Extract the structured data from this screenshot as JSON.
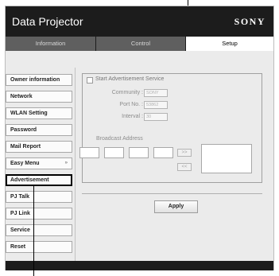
{
  "header": {
    "title": "Data Projector",
    "brand": "SONY"
  },
  "tabs": [
    {
      "label": "Information"
    },
    {
      "label": "Control"
    },
    {
      "label": "Setup"
    }
  ],
  "sidebar": {
    "items": [
      {
        "label": "Owner information"
      },
      {
        "label": "Network"
      },
      {
        "label": "WLAN Setting"
      },
      {
        "label": "Password"
      },
      {
        "label": "Mail Report"
      },
      {
        "label": "Easy Menu",
        "chevron": "»"
      },
      {
        "label": "Advertisement",
        "selected": true
      },
      {
        "label": "PJ Talk"
      },
      {
        "label": "PJ Link"
      },
      {
        "label": "Service"
      },
      {
        "label": "Reset"
      }
    ]
  },
  "advertisement": {
    "start_service_label": "Start Advertisement Service",
    "start_service_checked": false,
    "community_label": "Community :",
    "community_value": "SONY",
    "port_label": "Port No. :",
    "port_value": "53862",
    "interval_label": "Interval :",
    "interval_value": "30",
    "broadcast_label": "Broadcast Address",
    "add_arrow": ">>",
    "remove_arrow": "<<"
  },
  "apply_label": "Apply",
  "colors": {
    "header_bg": "#1c1c1c",
    "tab_inactive": "#5f5f5f",
    "content_bg": "#ebebeb"
  }
}
